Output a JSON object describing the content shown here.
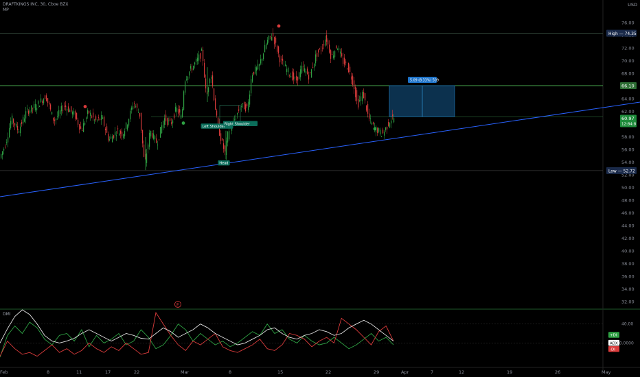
{
  "header": {
    "symbol_line": "DRAFTKINGS INC, 30, Cboe BZX",
    "sub": "MP",
    "currency": "USD"
  },
  "colors": {
    "bg": "#000000",
    "up": "#2ea043",
    "down": "#d93b3b",
    "trend": "#2962ff",
    "level": "#4caf50",
    "box": "#0e3a5c",
    "label_bg": "#0b6e5b",
    "di_plus": "#2ea043",
    "di_minus": "#d93b3b",
    "adx": "#e0e0e0"
  },
  "chart_data": [
    {
      "type": "candlestick",
      "title": "DRAFTKINGS INC, 30, Cboe BZX",
      "ylabel": "USD",
      "ylim": [
        31,
        77
      ],
      "y_ticks": [
        76,
        74,
        72,
        70,
        68,
        66,
        64,
        62,
        60,
        58,
        56,
        54,
        52,
        50,
        48,
        46,
        44,
        42,
        40,
        38,
        36,
        34,
        32
      ],
      "x_ticks": [
        "Feb",
        "8",
        "11",
        "17",
        "22",
        "Mar",
        "8",
        "15",
        "22",
        "29",
        "Apr",
        "7",
        "12",
        "19",
        "26",
        "May"
      ],
      "grid": false,
      "price_path": [
        [
          0,
          54.5
        ],
        [
          8,
          56.5
        ],
        [
          12,
          58
        ],
        [
          18,
          61
        ],
        [
          28,
          59
        ],
        [
          40,
          62
        ],
        [
          55,
          63
        ],
        [
          68,
          64.5
        ],
        [
          80,
          60.5
        ],
        [
          95,
          63
        ],
        [
          110,
          61.5
        ],
        [
          120,
          59
        ],
        [
          130,
          62
        ],
        [
          140,
          60.5
        ],
        [
          150,
          61
        ],
        [
          160,
          57.5
        ],
        [
          172,
          59
        ],
        [
          180,
          58.5
        ],
        [
          186,
          60
        ],
        [
          196,
          63.5
        ],
        [
          205,
          61.5
        ],
        [
          212,
          53.5
        ],
        [
          220,
          59
        ],
        [
          230,
          57
        ],
        [
          240,
          61
        ],
        [
          250,
          60
        ],
        [
          258,
          62.5
        ],
        [
          266,
          61
        ],
        [
          270,
          67
        ],
        [
          278,
          68.5
        ],
        [
          288,
          70
        ],
        [
          296,
          71.5
        ],
        [
          302,
          64
        ],
        [
          308,
          68.5
        ],
        [
          318,
          60
        ],
        [
          325,
          57
        ],
        [
          329,
          55.5
        ],
        [
          334,
          59
        ],
        [
          340,
          60
        ],
        [
          352,
          63
        ],
        [
          362,
          62.5
        ],
        [
          368,
          68
        ],
        [
          378,
          69
        ],
        [
          390,
          73
        ],
        [
          398,
          74.2
        ],
        [
          410,
          70
        ],
        [
          420,
          68.5
        ],
        [
          432,
          66.8
        ],
        [
          442,
          69
        ],
        [
          452,
          67.5
        ],
        [
          462,
          71
        ],
        [
          470,
          72
        ],
        [
          476,
          73.8
        ],
        [
          484,
          70.5
        ],
        [
          492,
          72.5
        ],
        [
          500,
          70
        ],
        [
          508,
          69
        ],
        [
          516,
          66.5
        ],
        [
          522,
          63
        ],
        [
          530,
          65
        ],
        [
          538,
          61
        ],
        [
          546,
          59.5
        ],
        [
          552,
          59
        ],
        [
          558,
          58.4
        ],
        [
          564,
          59.5
        ],
        [
          570,
          60.8
        ],
        [
          573,
          61
        ]
      ],
      "levels": {
        "high": {
          "label": "High",
          "value": 74.35
        },
        "low": {
          "label": "Low",
          "value": 52.72
        },
        "resistance": 66.1
      },
      "price_badges": [
        "60.97",
        "12:84:8"
      ],
      "target_box": {
        "price_top": 66.1,
        "price_bottom": 61.2,
        "label": "5.09 (8.33%) 509"
      },
      "annotations": [
        {
          "text": "Left Shoulder",
          "x": 316,
          "y": 59.7
        },
        {
          "text": "Head",
          "x": 326,
          "y": 53.9
        },
        {
          "text": "Right Shoulder",
          "x": 350,
          "y": 60.1
        }
      ],
      "markers": [
        {
          "color": "down",
          "x": 124,
          "y": 62.8
        },
        {
          "color": "down",
          "x": 406,
          "y": 75.5
        },
        {
          "color": "up",
          "x": 267,
          "y": 60.2
        },
        {
          "color": "up",
          "x": 546,
          "y": 59.3
        }
      ],
      "trendline": [
        [
          0,
          48.6
        ],
        [
          932,
          63.5
        ]
      ]
    },
    {
      "type": "line",
      "title": "DMI",
      "ylim": [
        0,
        55
      ],
      "y_ticks": [
        40,
        20
      ],
      "series": [
        {
          "name": "+DI",
          "color": "di_plus",
          "values": [
            5,
            28,
            38,
            30,
            42,
            36,
            24,
            18,
            28,
            30,
            22,
            34,
            16,
            28,
            20,
            24,
            30,
            18,
            22,
            34,
            26,
            14,
            18,
            28,
            40,
            34,
            22,
            30,
            24,
            18,
            22,
            16,
            20,
            26,
            32,
            28,
            40,
            30,
            34,
            24,
            20,
            28,
            22,
            18,
            20,
            26,
            20,
            14,
            18,
            24,
            30,
            22,
            26,
            18
          ]
        },
        {
          "name": "-DI",
          "color": "di_minus",
          "values": [
            6,
            22,
            14,
            8,
            10,
            6,
            12,
            18,
            10,
            14,
            8,
            12,
            20,
            14,
            10,
            16,
            12,
            20,
            14,
            8,
            10,
            52,
            40,
            28,
            18,
            12,
            22,
            18,
            24,
            30,
            16,
            12,
            10,
            14,
            18,
            24,
            14,
            12,
            18,
            30,
            28,
            24,
            16,
            22,
            26,
            20,
            46,
            40,
            34,
            26,
            18,
            32,
            38,
            22
          ]
        },
        {
          "name": "ADX",
          "color": "adx",
          "values": [
            20,
            35,
            48,
            55,
            50,
            40,
            28,
            22,
            20,
            22,
            25,
            30,
            34,
            30,
            26,
            22,
            26,
            30,
            28,
            25,
            24,
            30,
            36,
            32,
            26,
            30,
            34,
            40,
            36,
            30,
            26,
            22,
            18,
            20,
            24,
            28,
            34,
            36,
            30,
            26,
            24,
            28,
            30,
            34,
            32,
            28,
            30,
            36,
            40,
            44,
            40,
            34,
            28,
            22
          ]
        }
      ],
      "legend_badges": [
        "+DI",
        "ADX",
        "-DI"
      ],
      "axis_labels": [
        "40.00",
        "20.0000"
      ],
      "event_marker": "E"
    }
  ]
}
